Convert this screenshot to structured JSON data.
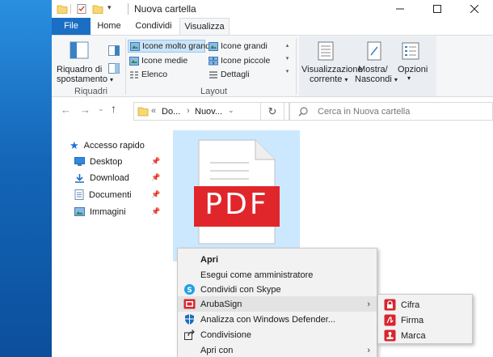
{
  "window": {
    "title": "Nuova cartella"
  },
  "tabs": [
    {
      "label": "File"
    },
    {
      "label": "Home"
    },
    {
      "label": "Condividi"
    },
    {
      "label": "Visualizza"
    }
  ],
  "ribbon": {
    "riquadri": {
      "button_line1": "Riquadro di",
      "button_line2": "spostamento",
      "group_label": "Riquadri"
    },
    "layout": {
      "items": [
        {
          "label": "Icone molto grandi",
          "selected": true
        },
        {
          "label": "Icone grandi"
        },
        {
          "label": "Icone medie"
        },
        {
          "label": "Icone piccole"
        },
        {
          "label": "Elenco"
        },
        {
          "label": "Dettagli"
        }
      ],
      "group_label": "Layout"
    },
    "current_view": {
      "line1": "Visualizzazione",
      "line2": "corrente"
    },
    "show_hide": {
      "line1": "Mostra/",
      "line2": "Nascondi"
    },
    "options": {
      "label": "Opzioni"
    }
  },
  "address": {
    "breadcrumb_1": "Do...",
    "breadcrumb_2": "Nuov...",
    "search_placeholder": "Cerca in Nuova cartella"
  },
  "navpane": {
    "quick_access": "Accesso rapido",
    "items": [
      {
        "label": "Desktop"
      },
      {
        "label": "Download"
      },
      {
        "label": "Documenti"
      },
      {
        "label": "Immagini"
      }
    ]
  },
  "file": {
    "icon_text": "PDF"
  },
  "context_menu": {
    "items": [
      {
        "label": "Apri"
      },
      {
        "label": "Esegui come amministratore"
      },
      {
        "label": "Condividi con Skype"
      },
      {
        "label": "ArubaSign"
      },
      {
        "label": "Analizza con Windows Defender..."
      },
      {
        "label": "Condivisione"
      },
      {
        "label": "Apri con"
      }
    ]
  },
  "submenu": {
    "items": [
      {
        "label": "Cifra"
      },
      {
        "label": "Firma"
      },
      {
        "label": "Marca"
      }
    ]
  },
  "colors": {
    "accent": "#1a6fc4",
    "pdf_red": "#e0262b",
    "selection": "#cce8ff",
    "aruba_red": "#d7262f"
  }
}
